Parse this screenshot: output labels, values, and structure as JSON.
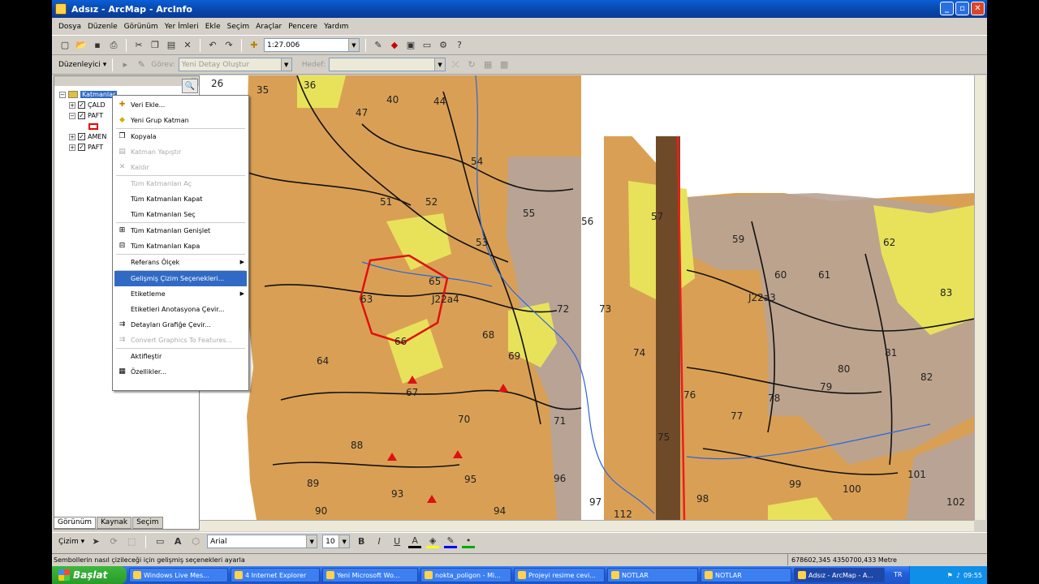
{
  "window": {
    "title": "Adsız - ArcMap - ArcInfo"
  },
  "menubar": [
    "Dosya",
    "Düzenle",
    "Görünüm",
    "Yer İmleri",
    "Ekle",
    "Seçim",
    "Araçlar",
    "Pencere",
    "Yardım"
  ],
  "toolbar": {
    "scale": "1:27.006"
  },
  "editor": {
    "editor_label": "Düzenleyici ▾",
    "task_label": "Görev:",
    "task_value": "Yeni Detay Oluştur",
    "target_label": "Hedef:",
    "target_value": ""
  },
  "toc": {
    "title": "Katmanlar",
    "layers": [
      "ÇALD",
      "PAFT",
      "AMEN",
      "PAFT"
    ]
  },
  "context_menu": {
    "items": [
      {
        "label": "Veri Ekle...",
        "icon": "plus-icon",
        "disabled": false
      },
      {
        "label": "Yeni Grup Katman",
        "icon": "group-layer-icon",
        "disabled": false
      },
      {
        "label": "Kopyala",
        "icon": "copy-icon",
        "disabled": false
      },
      {
        "label": "Katman Yapıştır",
        "icon": "paste-icon",
        "disabled": true
      },
      {
        "label": "Kaldır",
        "icon": "remove-icon",
        "disabled": true
      },
      {
        "label": "Tüm Katmanları Aç",
        "icon": "",
        "disabled": true
      },
      {
        "label": "Tüm Katmanları Kapat",
        "icon": "",
        "disabled": false
      },
      {
        "label": "Tüm Katmanları Seç",
        "icon": "",
        "disabled": false
      },
      {
        "label": "Tüm Katmanları Genişlet",
        "icon": "expand-icon",
        "disabled": false
      },
      {
        "label": "Tüm Katmanları Kapa",
        "icon": "collapse-icon",
        "disabled": false
      },
      {
        "label": "Referans Ölçek",
        "icon": "",
        "disabled": false
      },
      {
        "label": "Gelişmiş Çizim Seçenekleri...",
        "icon": "",
        "disabled": false
      },
      {
        "label": "Etiketleme",
        "icon": "",
        "disabled": false
      },
      {
        "label": "Etiketleri Anotasyona Çevir...",
        "icon": "",
        "disabled": false
      },
      {
        "label": "Detayları Grafiğe Çevir...",
        "icon": "convert-icon",
        "disabled": false
      },
      {
        "label": "Convert Graphics To Features...",
        "icon": "convert-graphics-icon",
        "disabled": true
      },
      {
        "label": "Aktifleştir",
        "icon": "",
        "disabled": false
      },
      {
        "label": "Özellikler...",
        "icon": "properties-icon",
        "disabled": false
      }
    ]
  },
  "toc_tabs": [
    "Görünüm",
    "Kaynak",
    "Seçim"
  ],
  "map": {
    "polygon_labels": [
      "26",
      "35",
      "36",
      "40",
      "44",
      "47",
      "51",
      "52",
      "53",
      "54",
      "55",
      "56",
      "57",
      "59",
      "60",
      "61",
      "62",
      "63",
      "64",
      "65",
      "66",
      "67",
      "68",
      "69",
      "70",
      "71",
      "72",
      "73",
      "74",
      "75",
      "76",
      "77",
      "78",
      "79",
      "80",
      "81",
      "82",
      "83",
      "88",
      "89",
      "90",
      "93",
      "94",
      "95",
      "96",
      "97",
      "98",
      "99",
      "100",
      "101",
      "102",
      "112"
    ],
    "sheet_labels": [
      "J22a4",
      "J22a3"
    ],
    "colors": {
      "orange": "#d9a055",
      "yellow": "#e8e25a",
      "mauve": "#b8a394",
      "red": "#ee1c1c"
    }
  },
  "drawing": {
    "select_label": "Çizim ▾",
    "font": "Arial",
    "size": "10"
  },
  "status": {
    "message": "Sembollerin nasıl çizileceği için gelişmiş seçenekleri ayarla",
    "coords": "678602,345  4350700,433 Metre"
  },
  "taskbar": {
    "start": "Başlat",
    "tasks": [
      "Windows Live Mes...",
      "4 Internet Explorer",
      "Yeni Microsoft Wo...",
      "nokta_poligon - Mi...",
      "Projeyi resime cevi...",
      "NOTLAR",
      "NOTLAR",
      "Adsız - ArcMap - A..."
    ],
    "lang": "TR",
    "clock": "09:55"
  }
}
